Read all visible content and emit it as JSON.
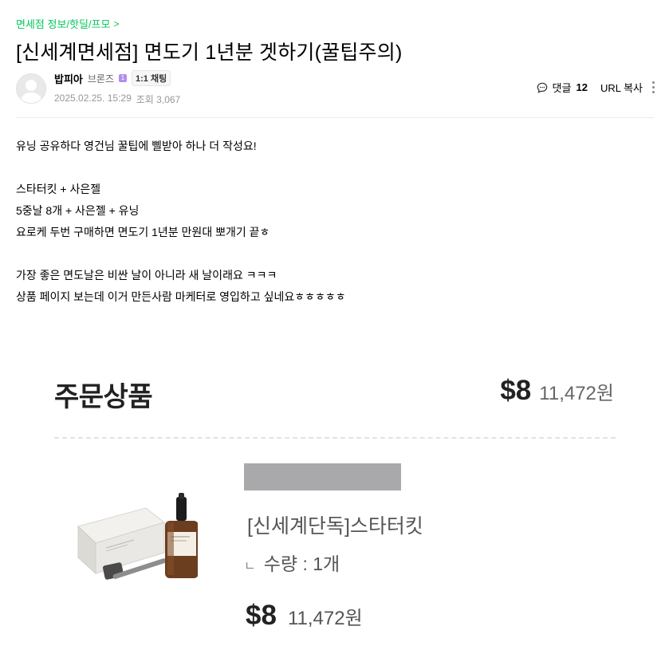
{
  "breadcrumb": {
    "label": "면세점 정보/핫딜/프모",
    "chevron": ">"
  },
  "post": {
    "title": "[신세계면세점] 면도기 1년분 겟하기(꿀팁주의)"
  },
  "author": {
    "nickname": "밥피아",
    "grade": "브론즈",
    "grade_badge": "1",
    "chat_label": "1:1 채팅",
    "date": "2025.02.25. 15:29",
    "views": "조회 3,067"
  },
  "tools": {
    "comment_label": "댓글",
    "comment_count": "12",
    "url_copy": "URL 복사"
  },
  "body": {
    "lines": [
      "유닝 공유하다 영건님 꿀팁에 삘받아 하나 더 작성요!",
      "",
      "스타터킷 + 사은젤",
      "5중날 8개 + 사은젤 + 유닝",
      "요로케 두번 구매하면 면도기 1년분 만원대 뽀개기 끝ㅎ",
      "",
      "가장 좋은 면도날은 비싼 날이 아니라 새 날이래요 ㅋㅋㅋ",
      "상품 페이지 보는데 이거 만든사람 마케터로 영입하고 싶네요ㅎㅎㅎㅎㅎ"
    ]
  },
  "order": {
    "title": "주문상품",
    "total_usd": "$8",
    "total_krw": "11,472원",
    "product_name": "[신세계단독]스타터킷",
    "qty_mark": "ㄴ",
    "qty": "수량 : 1개",
    "item_usd": "$8",
    "item_krw": "11,472원"
  },
  "colors": {
    "breadcrumb": "#03c75a",
    "grade_icon": "#b18cf0",
    "placeholder_bar": "#a9a9ab"
  },
  "icons": [
    "comment-icon",
    "more-icon",
    "avatar",
    "product-image"
  ]
}
